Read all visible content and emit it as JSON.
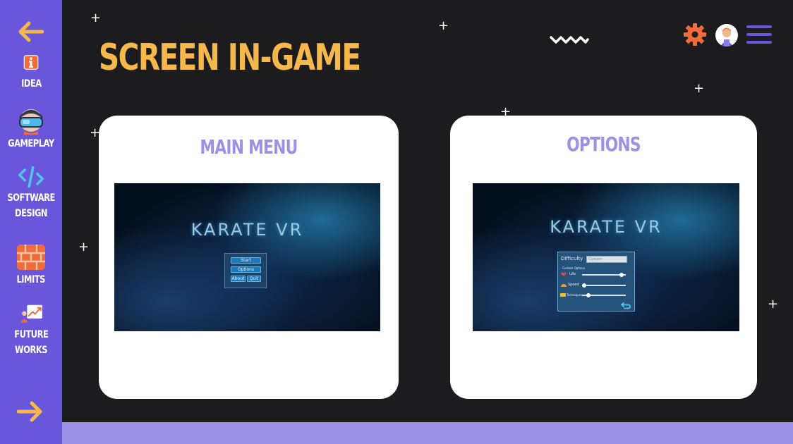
{
  "sidebar": {
    "items": [
      {
        "label_lines": [
          "IDEA"
        ],
        "icon": "info-icon"
      },
      {
        "label_lines": [
          "GAMEPLAY"
        ],
        "icon": "vr-headset-icon"
      },
      {
        "label_lines": [
          "SOFTWARE",
          "DESIGN"
        ],
        "icon": "code-icon"
      },
      {
        "label_lines": [
          "LIMITS"
        ],
        "icon": "brick-wall-icon"
      },
      {
        "label_lines": [
          "FUTURE",
          "WORKS"
        ],
        "icon": "growth-chart-icon"
      }
    ],
    "back_icon": "arrow-left-icon",
    "next_icon": "arrow-right-icon"
  },
  "header": {
    "title": "SCREEN IN-GAME",
    "settings_icon": "gear-icon",
    "avatar_icon": "avatar",
    "menu_icon": "hamburger-menu-icon"
  },
  "cards": [
    {
      "title": "MAIN MENU",
      "screenshot": {
        "game_title": "KARATE VR",
        "buttons": [
          "Start",
          "Options",
          "About",
          "Quit"
        ]
      }
    },
    {
      "title": "OPTIONS",
      "screenshot": {
        "game_title": "KARATE VR",
        "difficulty_label": "Difficulty",
        "difficulty_value": "Custom",
        "custom_options_label": "Custom Options",
        "sliders": [
          {
            "label": "Life",
            "value": 0.95
          },
          {
            "label": "Speed",
            "value": 0.0
          },
          {
            "label": "Techniques",
            "value": 0.1
          }
        ],
        "back_icon": "return-arrow-icon"
      }
    }
  ],
  "colors": {
    "background": "#1c1b1d",
    "sidebar": "#6a56db",
    "title": "#f7b84b",
    "card_title": "#9b92e6",
    "bottom_bar": "#9b92e6",
    "gear": "#f26b3a"
  }
}
